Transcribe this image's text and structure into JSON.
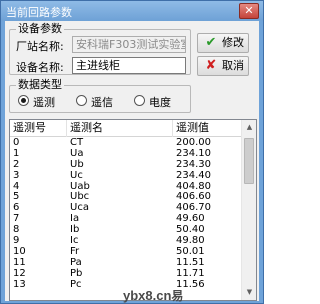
{
  "window": {
    "title": "当前回路参数",
    "close_label": "✕"
  },
  "device_params": {
    "legend": "设备参数",
    "factory_label": "厂站名称:",
    "factory_value": "安科瑞F303测试实验室",
    "device_label": "设备名称:",
    "device_value": "主进线柜"
  },
  "buttons": {
    "modify_label": "修改",
    "cancel_label": "取消"
  },
  "data_type": {
    "legend": "数据类型",
    "options": [
      {
        "label": "遥测",
        "selected": true
      },
      {
        "label": "遥信",
        "selected": false
      },
      {
        "label": "电度",
        "selected": false
      }
    ]
  },
  "table": {
    "columns": [
      "遥测号",
      "遥测名",
      "遥测值"
    ],
    "rows": [
      {
        "id": "0",
        "name": "CT",
        "value": "200.00"
      },
      {
        "id": "1",
        "name": "Ua",
        "value": "234.10"
      },
      {
        "id": "2",
        "name": "Ub",
        "value": "234.30"
      },
      {
        "id": "3",
        "name": "Uc",
        "value": "234.40"
      },
      {
        "id": "4",
        "name": "Uab",
        "value": "404.80"
      },
      {
        "id": "5",
        "name": "Ubc",
        "value": "406.60"
      },
      {
        "id": "6",
        "name": "Uca",
        "value": "406.70"
      },
      {
        "id": "7",
        "name": "Ia",
        "value": "49.60"
      },
      {
        "id": "8",
        "name": "Ib",
        "value": "50.40"
      },
      {
        "id": "9",
        "name": "Ic",
        "value": "49.80"
      },
      {
        "id": "10",
        "name": "Fr",
        "value": "50.01"
      },
      {
        "id": "11",
        "name": "Pa",
        "value": "11.51"
      },
      {
        "id": "12",
        "name": "Pb",
        "value": "11.71"
      },
      {
        "id": "13",
        "name": "Pc",
        "value": "11.56"
      }
    ]
  },
  "watermark": {
    "text": "ybx8.cn",
    "suffix": "易"
  }
}
